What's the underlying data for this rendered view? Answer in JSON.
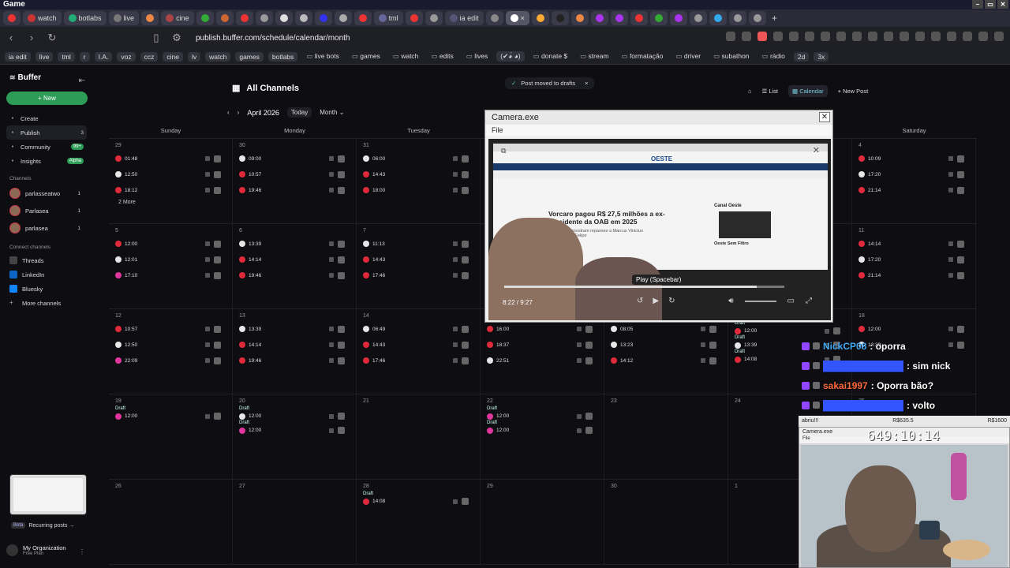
{
  "window": {
    "title": "Game"
  },
  "tabs": [
    {
      "label": "",
      "color": "#e33"
    },
    {
      "label": "watch",
      "color": "#c33"
    },
    {
      "label": "botlabs",
      "color": "#2a7"
    },
    {
      "label": "live",
      "color": "#777"
    },
    {
      "label": "",
      "color": "#e84"
    },
    {
      "label": "cine",
      "color": "#a44"
    },
    {
      "label": "",
      "color": "#3a3"
    },
    {
      "label": "",
      "color": "#c63"
    },
    {
      "label": "",
      "color": "#e33"
    },
    {
      "label": "",
      "color": "#999"
    },
    {
      "label": "",
      "color": "#ddd"
    },
    {
      "label": "",
      "color": "#bbb"
    },
    {
      "label": "",
      "color": "#33e"
    },
    {
      "label": "",
      "color": "#aaa"
    },
    {
      "label": "",
      "color": "#e33"
    },
    {
      "label": "tml",
      "color": "#669"
    },
    {
      "label": "",
      "color": "#e33"
    },
    {
      "label": "",
      "color": "#999"
    },
    {
      "label": "ia edit",
      "color": "#557"
    },
    {
      "label": "",
      "color": "#888"
    },
    {
      "label": "",
      "color": "#fff",
      "active": true
    },
    {
      "label": "",
      "color": "#fa3"
    },
    {
      "label": "",
      "color": "#222"
    },
    {
      "label": "",
      "color": "#e84"
    },
    {
      "label": "",
      "color": "#a3e"
    },
    {
      "label": "",
      "color": "#a3e"
    },
    {
      "label": "",
      "color": "#e33"
    },
    {
      "label": "",
      "color": "#3a3"
    },
    {
      "label": "",
      "color": "#a3e"
    },
    {
      "label": "",
      "color": "#999"
    },
    {
      "label": "",
      "color": "#3ae"
    },
    {
      "label": "",
      "color": "#999"
    },
    {
      "label": "",
      "color": "#999"
    }
  ],
  "address": {
    "url": "publish.buffer.com/schedule/calendar/month"
  },
  "bookmarks": [
    {
      "label": "ia edit",
      "folder": false
    },
    {
      "label": "live",
      "folder": false
    },
    {
      "label": "tml",
      "folder": false
    },
    {
      "label": "r",
      "folder": false
    },
    {
      "label": "I.A.",
      "folder": false
    },
    {
      "label": "voz",
      "folder": false
    },
    {
      "label": "ccz",
      "folder": false
    },
    {
      "label": "cine",
      "folder": false
    },
    {
      "label": "lv",
      "folder": false
    },
    {
      "label": "watch",
      "folder": false
    },
    {
      "label": "games",
      "folder": false
    },
    {
      "label": "botlabs",
      "folder": false
    },
    {
      "label": "live bots",
      "folder": true
    },
    {
      "label": "games",
      "folder": true
    },
    {
      "label": "watch",
      "folder": true
    },
    {
      "label": "edits",
      "folder": true
    },
    {
      "label": "lives",
      "folder": true
    },
    {
      "label": "(✔︎◕̀ ◕)",
      "folder": false
    },
    {
      "label": "donate $",
      "folder": true
    },
    {
      "label": "stream",
      "folder": true
    },
    {
      "label": "formatação",
      "folder": true
    },
    {
      "label": "driver",
      "folder": true
    },
    {
      "label": "subathon",
      "folder": true
    },
    {
      "label": "rádio",
      "folder": true
    },
    {
      "label": "2d",
      "folder": false
    },
    {
      "label": "3x",
      "folder": false
    }
  ],
  "sidebar": {
    "brand": "Buffer",
    "new_label": "New",
    "nav": [
      {
        "label": "Create",
        "icon": "plus-icon",
        "count": "",
        "badge": "",
        "active": false
      },
      {
        "label": "Publish",
        "icon": "publish-icon",
        "count": "3",
        "badge": "",
        "active": true
      },
      {
        "label": "Community",
        "icon": "community-icon",
        "count": "",
        "badge": "99+",
        "active": false
      },
      {
        "label": "Insights",
        "icon": "chart-icon",
        "count": "",
        "badge": "Alpha",
        "active": false
      }
    ],
    "channels_label": "Channels",
    "channels": [
      {
        "name": "parlasseatwo",
        "count": "1"
      },
      {
        "name": "Parlasea",
        "count": "1"
      },
      {
        "name": "parlasea",
        "count": "1"
      }
    ],
    "connect_label": "Connect channels",
    "connect": [
      {
        "name": "Threads",
        "color": "#444"
      },
      {
        "name": "LinkedIn",
        "color": "#0a66c2"
      },
      {
        "name": "Bluesky",
        "color": "#1185fe"
      },
      {
        "name": "More channels",
        "color": "transparent"
      }
    ],
    "recurring_beta": "Beta",
    "recurring_label": "Recurring posts →",
    "org_name": "My Organization",
    "org_plan": "Free Plan"
  },
  "main": {
    "title": "All Channels",
    "toast": "Post moved to drafts",
    "month": "April 2026",
    "today": "Today",
    "view_select": "Month",
    "list_label": "List",
    "calendar_label": "Calendar",
    "newpost_label": "New Post",
    "weekdays": [
      "Sunday",
      "Monday",
      "Tuesday",
      "Wednesday",
      "Thursday",
      "Friday",
      "Saturday"
    ]
  },
  "weeks": [
    [
      {
        "num": "29",
        "more": "2 More",
        "posts": [
          {
            "t": "01:48",
            "c": "red"
          },
          {
            "t": "12:50",
            "c": "white"
          },
          {
            "t": "18:12",
            "c": "red"
          }
        ]
      },
      {
        "num": "30",
        "more": "",
        "posts": [
          {
            "t": "09:00",
            "c": "white"
          },
          {
            "t": "10:57",
            "c": "red"
          },
          {
            "t": "19:46",
            "c": "red"
          }
        ]
      },
      {
        "num": "31",
        "more": "",
        "posts": [
          {
            "t": "06:00",
            "c": "white"
          },
          {
            "t": "14:43",
            "c": "red"
          },
          {
            "t": "18:00",
            "c": "red"
          }
        ]
      },
      {
        "num": "",
        "more": "",
        "posts": []
      },
      {
        "num": "",
        "more": "",
        "posts": []
      },
      {
        "num": "",
        "more": "",
        "posts": []
      },
      {
        "num": "4",
        "more": "",
        "posts": [
          {
            "t": "10:09",
            "c": "red"
          },
          {
            "t": "17:20",
            "c": "white"
          },
          {
            "t": "21:14",
            "c": "red"
          }
        ]
      }
    ],
    [
      {
        "num": "5",
        "more": "",
        "posts": [
          {
            "t": "12:00",
            "c": "red"
          },
          {
            "t": "12:01",
            "c": "white"
          },
          {
            "t": "17:10",
            "c": "pink"
          }
        ]
      },
      {
        "num": "6",
        "more": "",
        "posts": [
          {
            "t": "13:39",
            "c": "white"
          },
          {
            "t": "14:14",
            "c": "red"
          },
          {
            "t": "19:46",
            "c": "red"
          }
        ]
      },
      {
        "num": "7",
        "more": "",
        "posts": [
          {
            "t": "11:13",
            "c": "white"
          },
          {
            "t": "14:43",
            "c": "red"
          },
          {
            "t": "17:46",
            "c": "red"
          }
        ]
      },
      {
        "num": "",
        "more": "",
        "posts": []
      },
      {
        "num": "",
        "more": "",
        "posts": []
      },
      {
        "num": "",
        "more": "",
        "posts": []
      },
      {
        "num": "11",
        "more": "",
        "posts": [
          {
            "t": "14:14",
            "c": "red"
          },
          {
            "t": "17:20",
            "c": "white"
          },
          {
            "t": "21:14",
            "c": "red"
          }
        ]
      }
    ],
    [
      {
        "num": "12",
        "more": "",
        "posts": [
          {
            "t": "10:57",
            "c": "red"
          },
          {
            "t": "12:50",
            "c": "white"
          },
          {
            "t": "22:09",
            "c": "pink"
          }
        ]
      },
      {
        "num": "13",
        "more": "",
        "posts": [
          {
            "t": "13:39",
            "c": "white"
          },
          {
            "t": "14:14",
            "c": "red"
          },
          {
            "t": "19:46",
            "c": "red"
          }
        ]
      },
      {
        "num": "14",
        "more": "",
        "posts": [
          {
            "t": "06:49",
            "c": "white"
          },
          {
            "t": "14:43",
            "c": "red"
          },
          {
            "t": "17:46",
            "c": "red"
          }
        ]
      },
      {
        "num": "",
        "more": "",
        "posts": [
          {
            "t": "16:00",
            "c": "red"
          },
          {
            "t": "18:37",
            "c": "red"
          },
          {
            "t": "22:51",
            "c": "white"
          }
        ]
      },
      {
        "num": "",
        "more": "",
        "posts": [
          {
            "t": "08:05",
            "c": "white"
          },
          {
            "t": "13:23",
            "c": "white"
          },
          {
            "t": "14:12",
            "c": "red"
          }
        ]
      },
      {
        "num": "",
        "more": "",
        "posts": [
          {
            "t": "12:00",
            "c": "red",
            "draft": "Draft"
          },
          {
            "t": "13:39",
            "c": "white",
            "draft": "Draft"
          },
          {
            "t": "14:08",
            "c": "red",
            "draft": "Draft"
          }
        ]
      },
      {
        "num": "18",
        "more": "",
        "posts": [
          {
            "t": "12:00",
            "c": "red"
          },
          {
            "t": "13:39",
            "c": "white"
          }
        ]
      }
    ],
    [
      {
        "num": "19",
        "more": "",
        "posts": [
          {
            "t": "12:00",
            "c": "pink",
            "draft": "Draft"
          }
        ]
      },
      {
        "num": "20",
        "more": "",
        "posts": [
          {
            "t": "12:00",
            "c": "white",
            "draft": "Draft"
          },
          {
            "t": "12:00",
            "c": "pink",
            "draft": "Draft"
          }
        ]
      },
      {
        "num": "21",
        "more": "",
        "posts": []
      },
      {
        "num": "22",
        "more": "",
        "posts": [
          {
            "t": "12:00",
            "c": "pink",
            "draft": "Draft"
          },
          {
            "t": "12:00",
            "c": "pink",
            "draft": "Draft"
          }
        ]
      },
      {
        "num": "23",
        "more": "",
        "posts": []
      },
      {
        "num": "24",
        "more": "",
        "posts": []
      },
      {
        "num": "25",
        "more": "",
        "posts": []
      }
    ],
    [
      {
        "num": "26",
        "more": "",
        "posts": []
      },
      {
        "num": "27",
        "more": "",
        "posts": []
      },
      {
        "num": "28",
        "more": "",
        "posts": [
          {
            "t": "14:08",
            "c": "red",
            "draft": "Draft"
          }
        ]
      },
      {
        "num": "29",
        "more": "",
        "posts": []
      },
      {
        "num": "30",
        "more": "",
        "posts": []
      },
      {
        "num": "1",
        "more": "",
        "posts": []
      },
      {
        "num": "",
        "more": "",
        "posts": []
      }
    ]
  ],
  "camera": {
    "title": "Camera.exe",
    "menu_file": "File",
    "site_name": "OESTE",
    "headline": "Vorcaro pagou R$ 27,5 milhões a ex-presidente da OAB em 2025",
    "subline": "Receita mostram repasses a Marcus Vinicius Coêlho e Felipe",
    "side_title": "Canal Oeste",
    "side_sub": "Oeste Sem Filtro",
    "timecode": "8:22 / 9:27",
    "progress": 0.9,
    "tooltip": "Play (Spacebar)"
  },
  "chat": [
    {
      "user": "NickCP08",
      "user_color": "#3fa9f5",
      "msg": ": oporra"
    },
    {
      "user": "",
      "user_color": "#3355ff",
      "msg": ": sim nick"
    },
    {
      "user": "sakai1997",
      "user_color": "#ff6a3d",
      "msg": ": Oporra bão?"
    },
    {
      "user": "",
      "user_color": "#3355ff",
      "msg": ": volto"
    }
  ],
  "stream_stats": {
    "left": "abriu!!!",
    "mid": "R$635.5",
    "right": "R$1600"
  },
  "webcam": {
    "title": "Camera.exe",
    "file": "File",
    "timer": "649:10:14"
  }
}
